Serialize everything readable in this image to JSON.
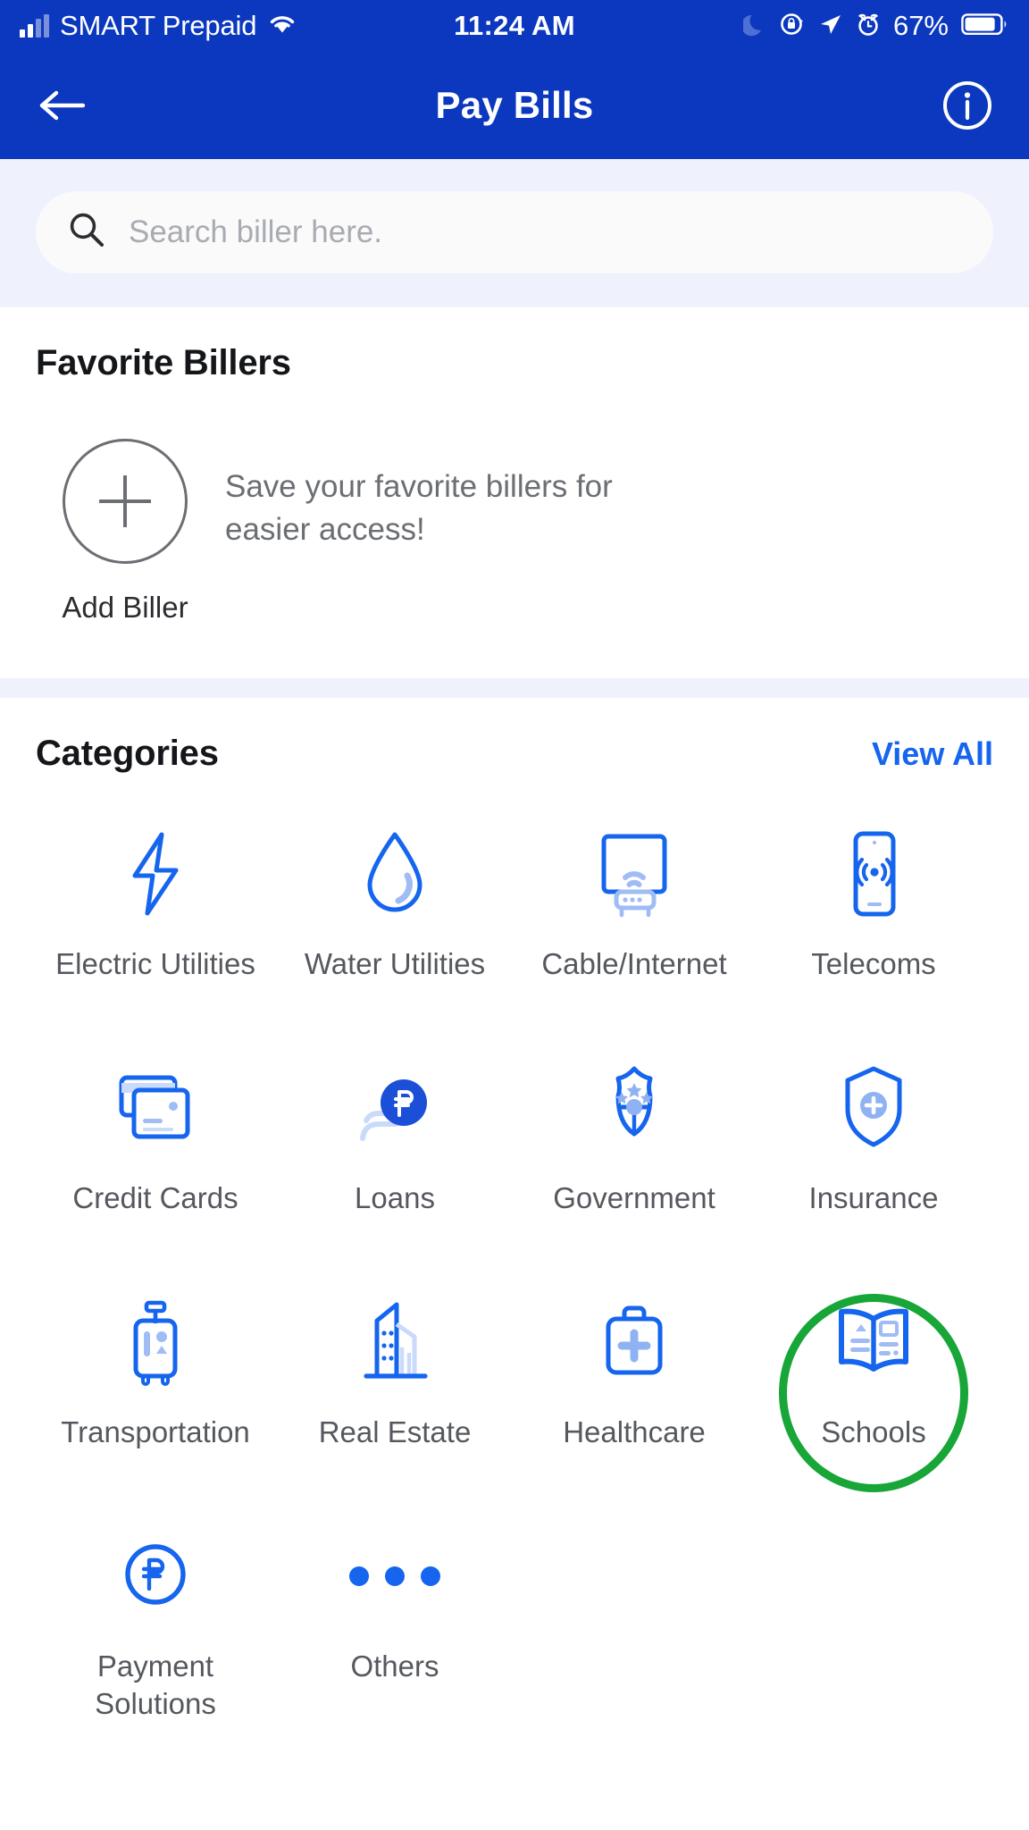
{
  "status_bar": {
    "carrier": "SMART Prepaid",
    "time": "11:24 AM",
    "battery_percent": "67%",
    "icons": [
      "signal-bars-icon",
      "wifi-icon",
      "moon-icon",
      "rotation-lock-icon",
      "location-arrow-icon",
      "alarm-icon",
      "battery-icon"
    ]
  },
  "app_bar": {
    "title": "Pay Bills",
    "back_icon": "arrow-left-icon",
    "info_icon": "info-circle-icon",
    "background_color": "#0B38BE"
  },
  "search": {
    "placeholder": "Search biller here.",
    "value": "",
    "icon": "search-icon"
  },
  "favorites": {
    "title": "Favorite Billers",
    "add_label": "Add Biller",
    "add_icon": "plus-icon",
    "empty_message": "Save your favorite billers for easier access!"
  },
  "categories": {
    "title": "Categories",
    "view_all_label": "View All",
    "view_all_color": "#1565EE",
    "highlight_color": "#17A637",
    "highlighted_item": "Schools",
    "items": [
      {
        "label": "Electric Utilities",
        "icon": "lightning-bolt-icon"
      },
      {
        "label": "Water Utilities",
        "icon": "water-droplet-icon"
      },
      {
        "label": "Cable/Internet",
        "icon": "tv-router-icon"
      },
      {
        "label": "Telecoms",
        "icon": "mobile-signal-icon"
      },
      {
        "label": "Credit Cards",
        "icon": "credit-cards-icon"
      },
      {
        "label": "Loans",
        "icon": "hand-peso-coin-icon"
      },
      {
        "label": "Government",
        "icon": "shield-stars-badge-icon"
      },
      {
        "label": "Insurance",
        "icon": "shield-plus-icon"
      },
      {
        "label": "Transportation",
        "icon": "luggage-icon"
      },
      {
        "label": "Real Estate",
        "icon": "buildings-icon"
      },
      {
        "label": "Healthcare",
        "icon": "medical-briefcase-icon"
      },
      {
        "label": "Schools",
        "icon": "open-book-icon"
      },
      {
        "label": "Payment Solutions",
        "icon": "peso-circle-icon"
      },
      {
        "label": "Others",
        "icon": "ellipsis-icon"
      }
    ]
  }
}
